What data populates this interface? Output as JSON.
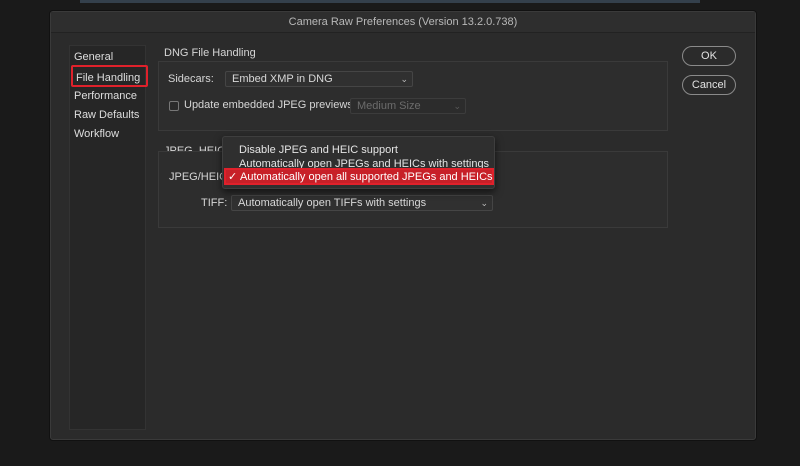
{
  "window": {
    "title": "Camera Raw Preferences  (Version 13.2.0.738)"
  },
  "sidebar": {
    "items": [
      {
        "label": "General"
      },
      {
        "label": "File Handling",
        "selected": true
      },
      {
        "label": "Performance"
      },
      {
        "label": "Raw Defaults"
      },
      {
        "label": "Workflow"
      }
    ]
  },
  "dng": {
    "title": "DNG File Handling",
    "sidecars_label": "Sidecars:",
    "sidecars_value": "Embed XMP in DNG",
    "update_previews_label": "Update embedded JPEG previews:",
    "update_previews_checked": false,
    "preview_size_value": "Medium Size"
  },
  "jpeg": {
    "title": "JPEG, HEIC,",
    "jpeg_label": "JPEG/HEIC",
    "tiff_label": "TIFF:",
    "tiff_value": "Automatically open TIFFs with settings"
  },
  "jpeg_menu": {
    "options": [
      {
        "label": "Disable JPEG and HEIC support",
        "checked": false
      },
      {
        "label": "Automatically open JPEGs and HEICs with settings",
        "checked": false
      },
      {
        "label": "Automatically open all supported JPEGs and HEICs",
        "checked": true
      }
    ],
    "check_glyph": "✓"
  },
  "buttons": {
    "ok": "OK",
    "cancel": "Cancel"
  },
  "colors": {
    "highlight": "#e0212b",
    "background": "#2b2b2b"
  },
  "icons": {
    "dropdown": "chevron-down-icon",
    "check": "checkmark-icon"
  }
}
